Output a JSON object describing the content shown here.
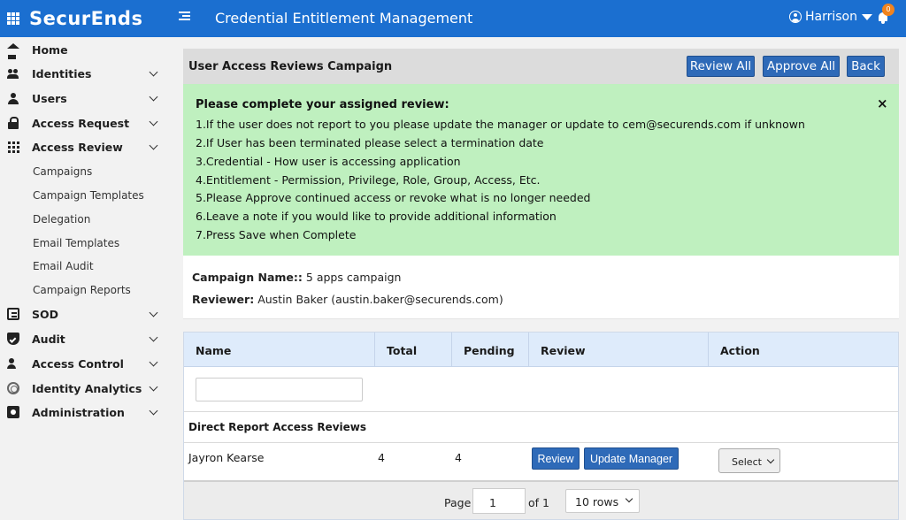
{
  "header": {
    "logo": "SecurEnds",
    "app_title": "Credential Entitlement Management",
    "user_name": "Harrison",
    "notification_count": "0"
  },
  "sidebar": {
    "items": [
      {
        "label": "Home",
        "icon": "home-icon"
      },
      {
        "label": "Identities",
        "icon": "identities-icon"
      },
      {
        "label": "Users",
        "icon": "user-icon"
      },
      {
        "label": "Access Request",
        "icon": "lock-icon"
      },
      {
        "label": "Access Review",
        "icon": "grid-icon"
      },
      {
        "label": "SOD",
        "icon": "list-icon"
      },
      {
        "label": "Audit",
        "icon": "shield-icon"
      },
      {
        "label": "Access Control",
        "icon": "user-gear-icon"
      },
      {
        "label": "Identity Analytics",
        "icon": "fingerprint-icon"
      },
      {
        "label": "Administration",
        "icon": "admin-icon"
      }
    ],
    "sub_items": [
      "Campaigns",
      "Campaign Templates",
      "Delegation",
      "Email Templates",
      "Email Audit",
      "Campaign Reports"
    ]
  },
  "panel": {
    "title": "User Access Reviews Campaign",
    "review_all": "Review All",
    "approve_all": "Approve All",
    "back": "Back"
  },
  "alert": {
    "close": "×",
    "heading": "Please complete your assigned review:",
    "lines": [
      "1.If the user does not report to you please update the manager or update to cem@securends.com if unknown",
      "2.If User has been terminated please select a termination date",
      "3.Credential - How user is accessing application",
      "4.Entitlement - Permission, Privilege, Role, Group, Access, Etc.",
      "5.Please Approve continued access or revoke what is no longer needed",
      "6.Leave a note if you would like to provide additional information",
      "7.Press Save when Complete"
    ]
  },
  "campaign": {
    "name_label": "Campaign Name::",
    "name_value": "5 apps campaign",
    "reviewer_label": "Reviewer:",
    "reviewer_value": "Austin Baker (austin.baker@securends.com)"
  },
  "table": {
    "columns": [
      "Name",
      "Total",
      "Pending",
      "Review",
      "Action"
    ],
    "filter_value": "",
    "group_label": "Direct Report Access Reviews",
    "rows": [
      {
        "name": "Jayron Kearse",
        "total": "4",
        "pending": "4",
        "review_btn": "Review",
        "update_btn": "Update Manager",
        "action": "Select"
      }
    ]
  },
  "pager": {
    "page_label": "Page",
    "page_value": "1",
    "of_label": "of 1",
    "rows_value": "10 rows"
  }
}
